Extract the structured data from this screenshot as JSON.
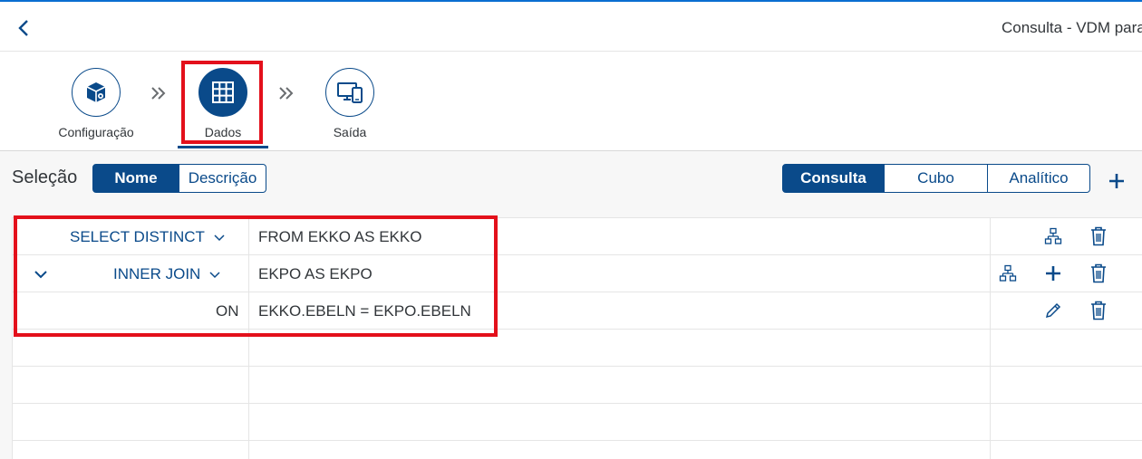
{
  "header": {
    "title": "Consulta - VDM para"
  },
  "steps": [
    {
      "label": "Configuração",
      "icon": "box-settings-icon",
      "active": false
    },
    {
      "label": "Dados",
      "icon": "grid-icon",
      "active": true
    },
    {
      "label": "Saída",
      "icon": "devices-icon",
      "active": false
    }
  ],
  "selection": {
    "label": "Seleção",
    "toggle": [
      "Nome",
      "Descrição"
    ],
    "toggle_selected": "Nome"
  },
  "view_toggle": {
    "options": [
      "Consulta",
      "Cubo",
      "Analítico"
    ],
    "selected": "Consulta"
  },
  "rows": [
    {
      "keyword": "SELECT DISTINCT",
      "expression": "FROM EKKO AS EKKO"
    },
    {
      "keyword": "INNER JOIN",
      "expression": "EKPO AS EKPO"
    },
    {
      "keyword": "ON",
      "expression": "EKKO.EBELN = EKPO.EBELN"
    }
  ],
  "colors": {
    "accent": "#0a4a8a",
    "highlight": "#e3101b"
  }
}
